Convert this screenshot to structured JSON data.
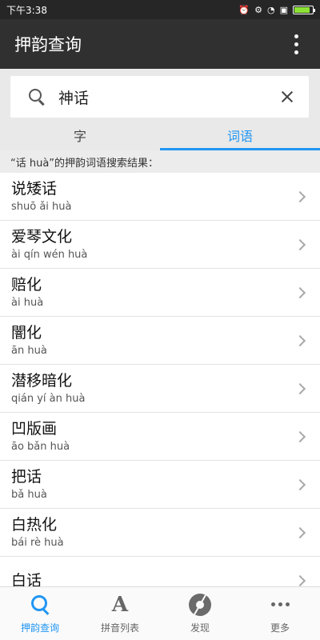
{
  "status_bar": {
    "time": "下午3:38",
    "alarm_icon": "alarm-icon",
    "wifi_icon": "wifi-icon",
    "battery_level": 0.85
  },
  "app_bar": {
    "title": "押韵查询",
    "overflow_icon": "more-vertical-icon"
  },
  "search": {
    "value": "神话",
    "search_icon": "search-icon",
    "clear_icon": "close-icon"
  },
  "tabs": [
    {
      "label": "字",
      "active": false
    },
    {
      "label": "词语",
      "active": true
    }
  ],
  "result_header": "“话 huà”的押韵词语搜索结果：",
  "results": [
    {
      "word": "说矮话",
      "pinyin": "shuō ǎi huà"
    },
    {
      "word": "爱琴文化",
      "pinyin": "ài qín wén huà"
    },
    {
      "word": "赔化",
      "pinyin": "ài huà"
    },
    {
      "word": "闇化",
      "pinyin": "ān huà"
    },
    {
      "word": "潜移暗化",
      "pinyin": "qián yí àn huà"
    },
    {
      "word": "凹版画",
      "pinyin": "āo bǎn huà"
    },
    {
      "word": "把话",
      "pinyin": "bǎ huà"
    },
    {
      "word": "白热化",
      "pinyin": "bái rè huà"
    },
    {
      "word": "白话",
      "pinyin": ""
    }
  ],
  "bottom_nav": [
    {
      "label": "押韵查询",
      "icon": "search-icon",
      "active": true
    },
    {
      "label": "拼音列表",
      "icon": "font-icon",
      "active": false
    },
    {
      "label": "发现",
      "icon": "aperture-icon",
      "active": false
    },
    {
      "label": "更多",
      "icon": "more-horizontal-icon",
      "active": false
    }
  ],
  "colors": {
    "accent": "#2196f3",
    "app_bar": "#303030",
    "status_bar": "#262626"
  }
}
